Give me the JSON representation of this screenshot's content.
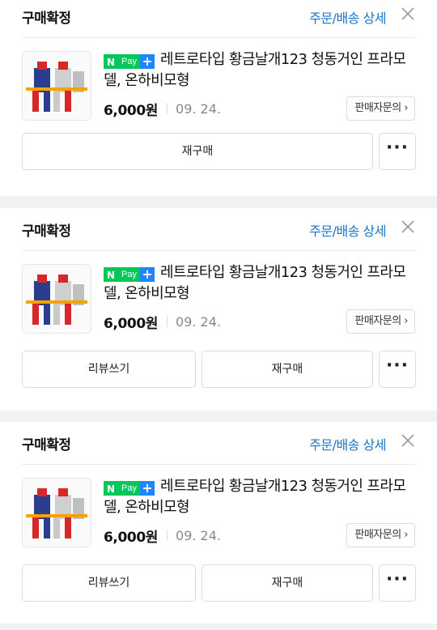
{
  "orders": [
    {
      "status": "구매확정",
      "detail_link": "주문/배송 상세",
      "npay": {
        "n": "N",
        "pay": "Pay",
        "plus": "+"
      },
      "title": "레트로타입 황금날개123 청동거인 프라모델, 온하비모형",
      "price": "6,000원",
      "date": "09. 24.",
      "inquiry": "판매자문의 ›",
      "buttons": [
        "재구매"
      ],
      "more": "···"
    },
    {
      "status": "구매확정",
      "detail_link": "주문/배송 상세",
      "npay": {
        "n": "N",
        "pay": "Pay",
        "plus": "+"
      },
      "title": "레트로타입 황금날개123 청동거인 프라모델, 온하비모형",
      "price": "6,000원",
      "date": "09. 24.",
      "inquiry": "판매자문의 ›",
      "buttons": [
        "리뷰쓰기",
        "재구매"
      ],
      "more": "···"
    },
    {
      "status": "구매확정",
      "detail_link": "주문/배송 상세",
      "npay": {
        "n": "N",
        "pay": "Pay",
        "plus": "+"
      },
      "title": "레트로타입 황금날개123 청동거인 프라모델, 온하비모형",
      "price": "6,000원",
      "date": "09. 24.",
      "inquiry": "판매자문의 ›",
      "buttons": [
        "리뷰쓰기",
        "재구매"
      ],
      "more": "···"
    }
  ],
  "colors": {
    "accent": "#1a73c9",
    "npay_green": "#03c75a",
    "npay_blue": "#1e86ff",
    "separator": "#f1f2f4"
  }
}
